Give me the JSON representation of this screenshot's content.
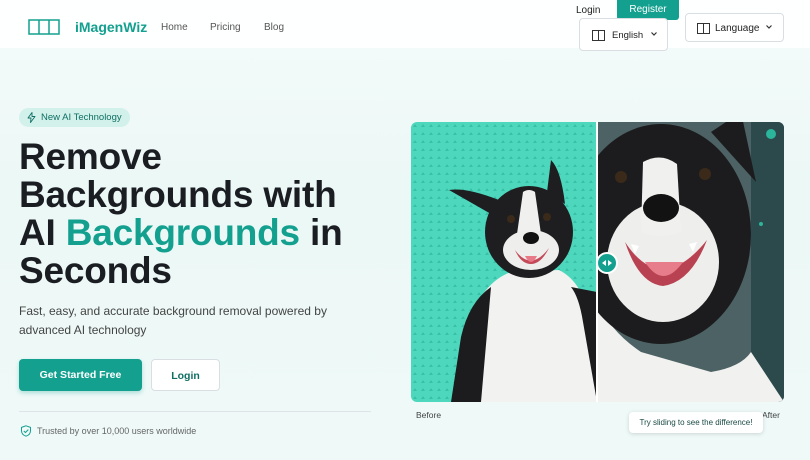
{
  "header": {
    "brand": "iMagenWiz",
    "nav": [
      "Home",
      "Pricing",
      "Blog"
    ],
    "login": "Login",
    "register": "Register",
    "language_dropdown_value": "English",
    "language_button": "Language"
  },
  "hero": {
    "badge": "New AI Technology",
    "headline_1": "Remove",
    "headline_2": "Backgrounds with",
    "headline_3a": "AI ",
    "headline_3b": "Backgrounds",
    "headline_3c": " in",
    "headline_4": "Seconds",
    "subtext": "Fast, easy, and accurate background removal powered by advanced AI technology",
    "cta_primary": "Get Started Free",
    "cta_secondary": "Login",
    "trust": "Trusted by over 10,000 users worldwide"
  },
  "compare": {
    "before_label": "Before",
    "after_label": "After",
    "hint": "Try sliding to see the difference!",
    "slider_position": 0.5
  },
  "colors": {
    "accent": "#13a08f",
    "checker": "#4dd8bd"
  },
  "icons": [
    "layout-icon",
    "language-icon",
    "chevron-down-icon",
    "bolt-icon",
    "shield-check-icon",
    "slider-handle-icon"
  ]
}
